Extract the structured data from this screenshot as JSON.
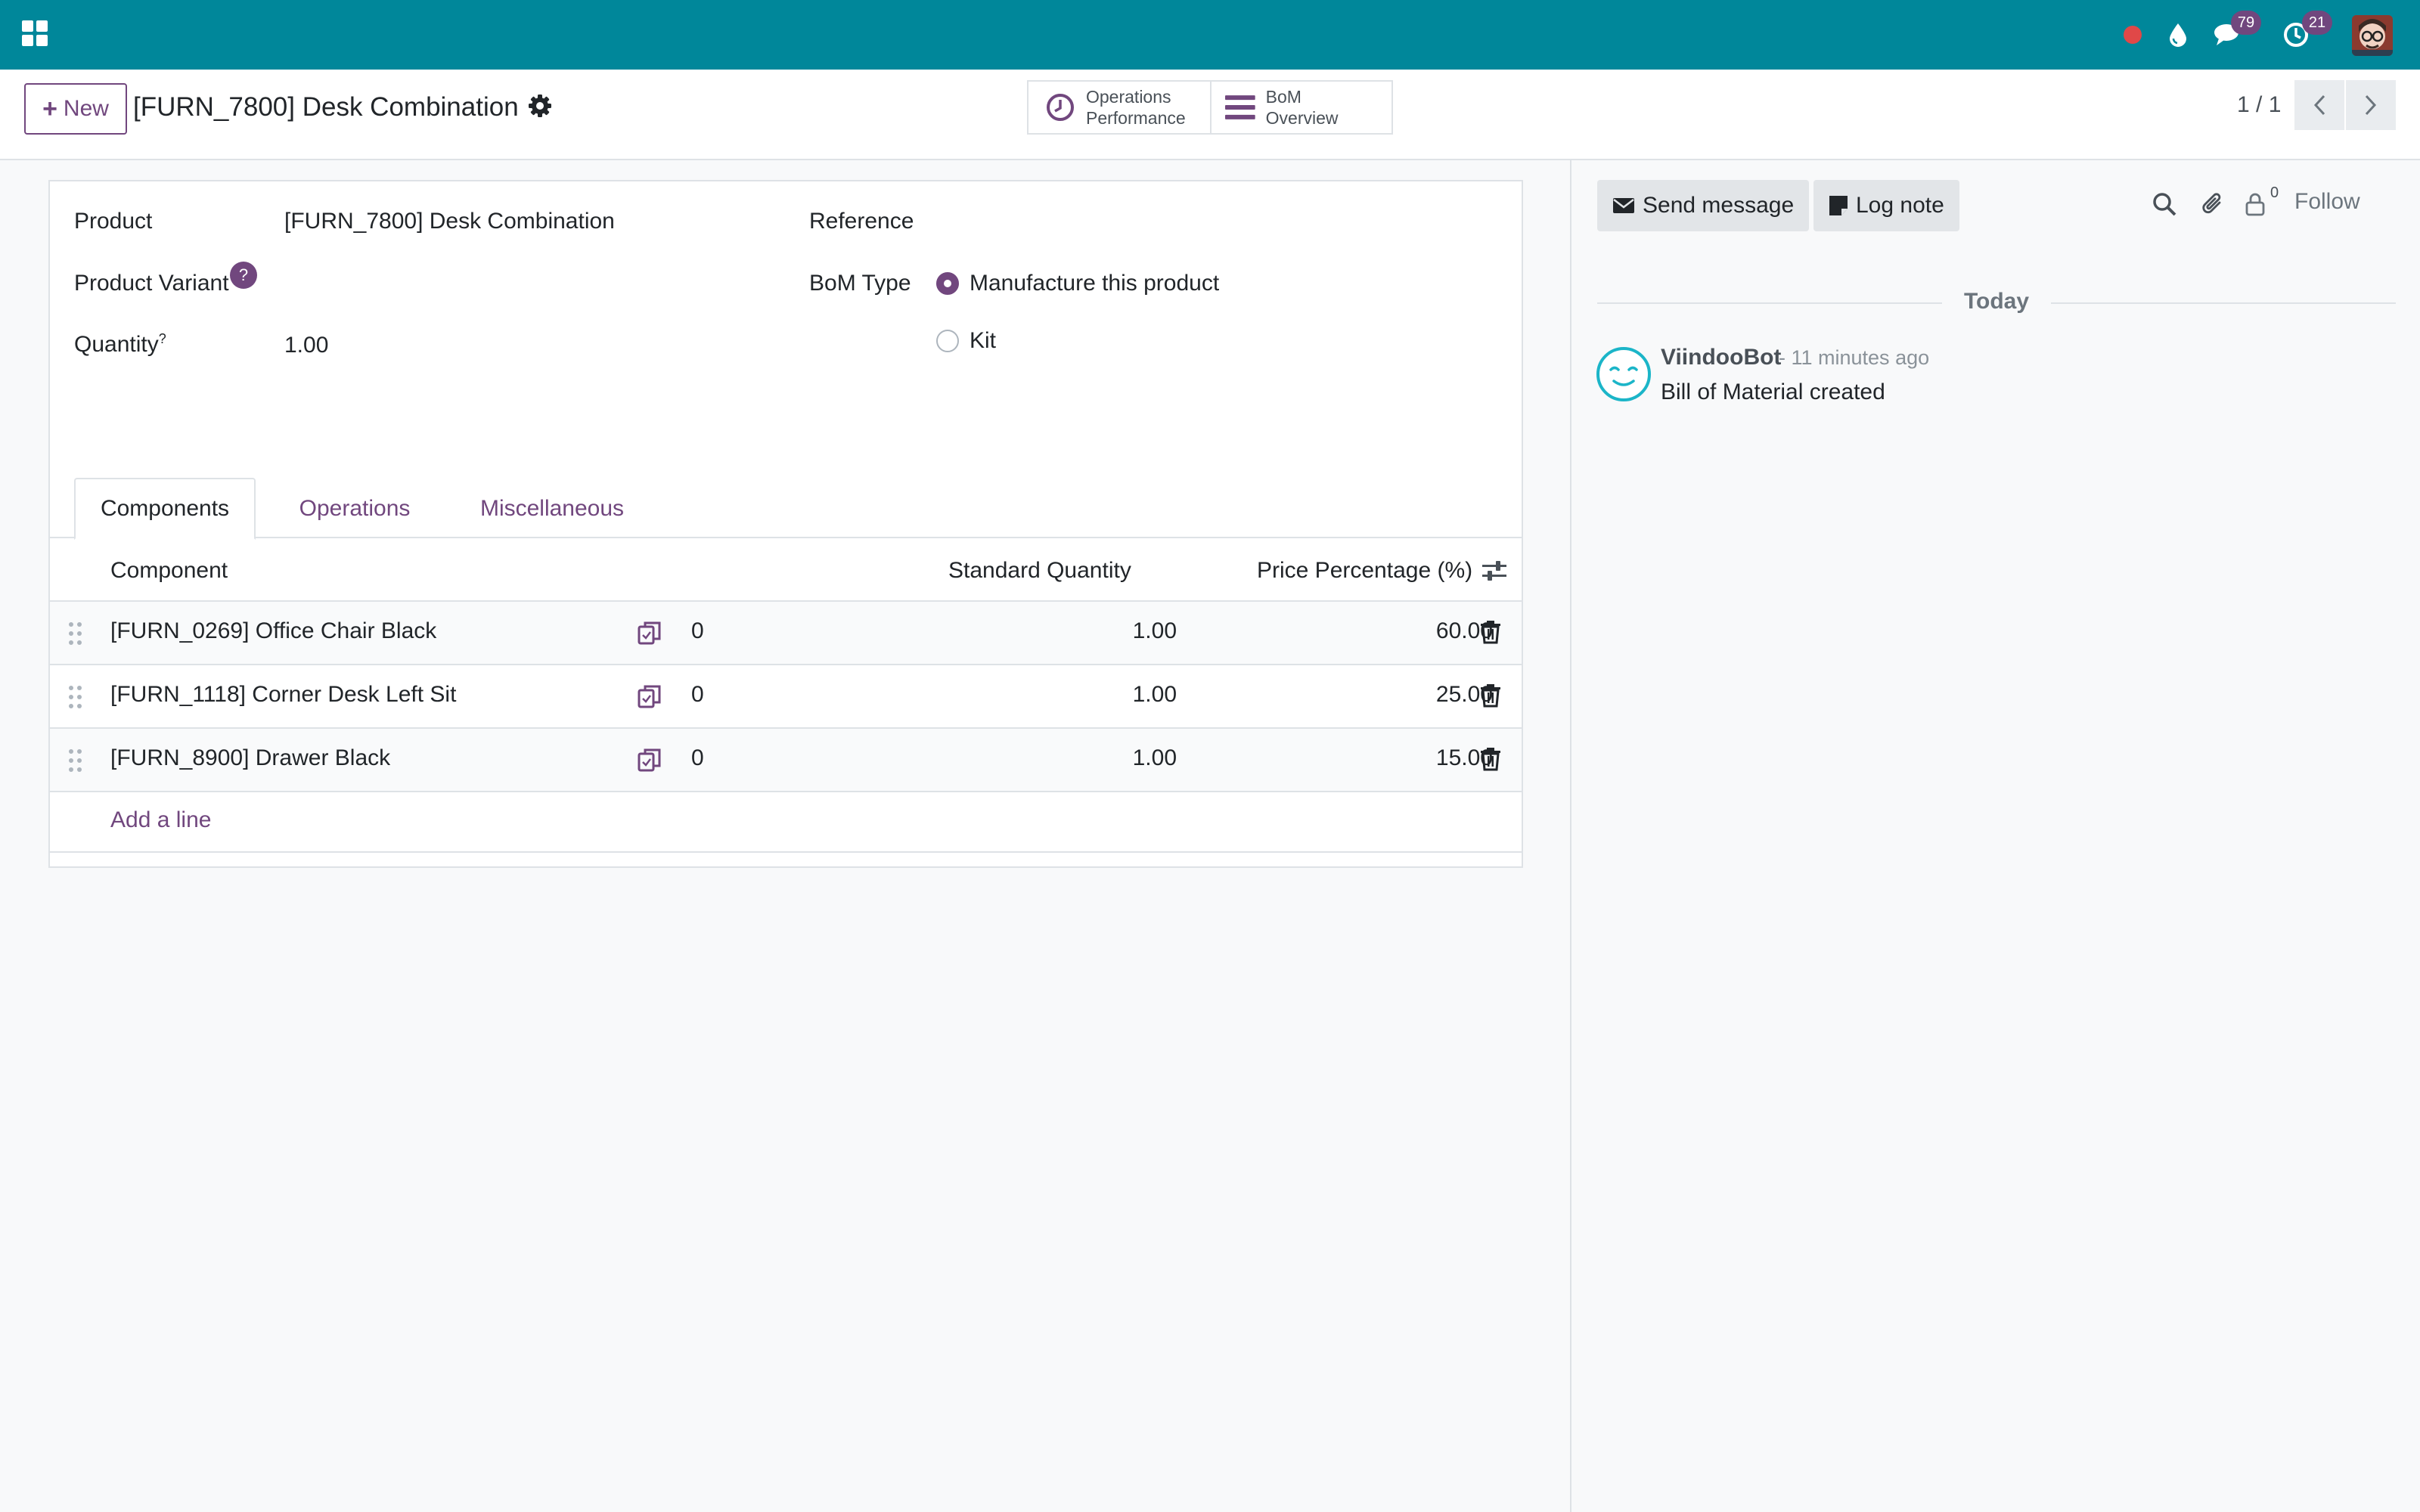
{
  "navbar": {
    "messages_count": "79",
    "activities_count": "21",
    "colors": {
      "background": "#00879a",
      "badge": "#71477e"
    }
  },
  "control_panel": {
    "new_label": "New",
    "record_title": "[FURN_7800] Desk Combination",
    "smart_buttons": {
      "operations_performance_line1": "Operations",
      "operations_performance_line2": "Performance",
      "bom_overview": "BoM Overview"
    },
    "pager": "1 / 1"
  },
  "form": {
    "product_label": "Product",
    "product_value": "[FURN_7800] Desk Combination",
    "product_variant_label": "Product Variant",
    "product_variant_help": "?",
    "quantity_label": "Quantity",
    "quantity_sup": "?",
    "quantity_value": "1.00",
    "reference_label": "Reference",
    "bom_type_label": "BoM Type",
    "bom_type_options": [
      "Manufacture this product",
      "Kit"
    ],
    "bom_type_selected": "Manufacture this product"
  },
  "tabs": [
    "Components",
    "Operations",
    "Miscellaneous"
  ],
  "active_tab": "Components",
  "components_table": {
    "headers": {
      "component": "Component",
      "standard_quantity": "Standard Quantity",
      "price_percentage": "Price Percentage (%)"
    },
    "rows": [
      {
        "component": "[FURN_0269] Office Chair Black",
        "count": "0",
        "qty": "1.00",
        "price_pct": "60.00"
      },
      {
        "component": "[FURN_1118] Corner Desk Left Sit",
        "count": "0",
        "qty": "1.00",
        "price_pct": "25.00"
      },
      {
        "component": "[FURN_8900] Drawer Black",
        "count": "0",
        "qty": "1.00",
        "price_pct": "15.00"
      }
    ],
    "add_line": "Add a line"
  },
  "chatter": {
    "send_message": "Send message",
    "log_note": "Log note",
    "followers_count": "0",
    "follow": "Follow",
    "date_separator": "Today",
    "messages": [
      {
        "author": "ViindooBot",
        "date": "- 11 minutes ago",
        "body": "Bill of Material created"
      }
    ]
  },
  "accent_color": "#71477e"
}
